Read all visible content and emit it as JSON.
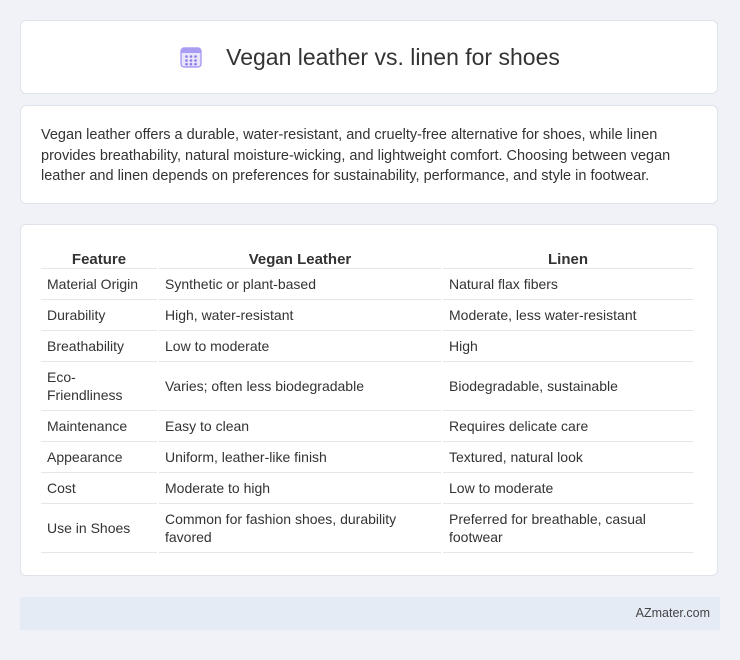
{
  "header": {
    "icon": "calendar-grid-icon",
    "title": "Vegan leather vs. linen for shoes"
  },
  "intro": {
    "text": "Vegan leather offers a durable, water-resistant, and cruelty-free alternative for shoes, while linen provides breathability, natural moisture-wicking, and lightweight comfort. Choosing between vegan leather and linen depends on preferences for sustainability, performance, and style in footwear."
  },
  "table": {
    "headers": [
      "Feature",
      "Vegan Leather",
      "Linen"
    ],
    "rows": [
      [
        "Material Origin",
        "Synthetic or plant-based",
        "Natural flax fibers"
      ],
      [
        "Durability",
        "High, water-resistant",
        "Moderate, less water-resistant"
      ],
      [
        "Breathability",
        "Low to moderate",
        "High"
      ],
      [
        "Eco-Friendliness",
        "Varies; often less biodegradable",
        "Biodegradable, sustainable"
      ],
      [
        "Maintenance",
        "Easy to clean",
        "Requires delicate care"
      ],
      [
        "Appearance",
        "Uniform, leather-like finish",
        "Textured, natural look"
      ],
      [
        "Cost",
        "Moderate to high",
        "Low to moderate"
      ],
      [
        "Use in Shoes",
        "Common for fashion shoes, durability favored",
        "Preferred for breathable, casual footwear"
      ]
    ]
  },
  "footer": {
    "brand": "AZmater.com"
  },
  "colors": {
    "background": "#f0f2f7",
    "card": "#ffffff",
    "footer_bg": "#e5ebf5",
    "icon_accent": "#7b68ee"
  }
}
